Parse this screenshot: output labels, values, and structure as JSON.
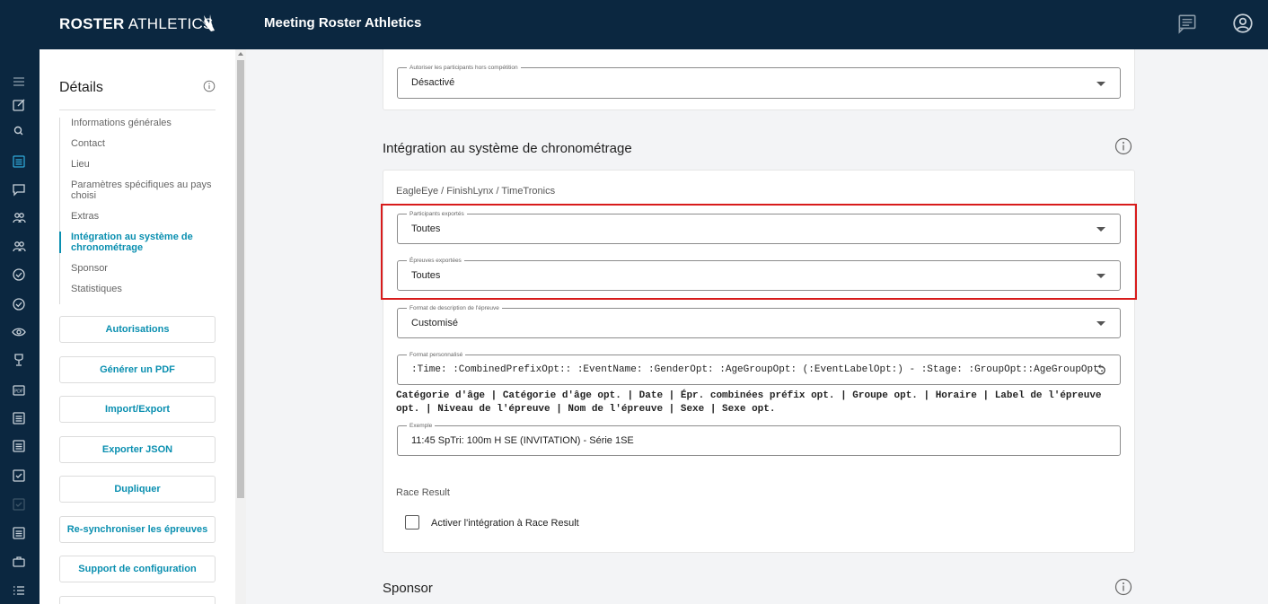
{
  "header": {
    "brand_bold": "ROSTER",
    "brand_light": "ATHLETICS",
    "app_title": "Meeting Roster Athletics",
    "icons": [
      "chat-icon",
      "account-icon"
    ]
  },
  "rail": {
    "icons": [
      "menu-icon",
      "edit-icon",
      "search-icon",
      "list-icon",
      "message-icon",
      "people-icon",
      "group-icon",
      "check-circle-icon",
      "check-circle-outline-icon",
      "eye-icon",
      "trophy-icon",
      "pdf-icon",
      "list-box-icon",
      "list-box-icon",
      "check-box-icon",
      "check-box-disabled-icon",
      "document-icon",
      "briefcase-icon",
      "list-bullets-icon"
    ]
  },
  "sidebar": {
    "title": "Détails",
    "nav": [
      {
        "label": "Informations générales"
      },
      {
        "label": "Contact"
      },
      {
        "label": "Lieu"
      },
      {
        "label": "Paramètres spécifiques au pays choisi"
      },
      {
        "label": "Extras"
      },
      {
        "label": "Intégration au système de chronométrage"
      },
      {
        "label": "Sponsor"
      },
      {
        "label": "Statistiques"
      }
    ],
    "buttons": [
      {
        "label": "Autorisations"
      },
      {
        "label": "Générer un PDF"
      },
      {
        "label": "Import/Export"
      },
      {
        "label": "Exporter JSON"
      },
      {
        "label": "Dupliquer"
      },
      {
        "label": "Re-synchroniser les épreuves"
      },
      {
        "label": "Support de configuration"
      }
    ]
  },
  "main": {
    "top_field": {
      "label": "Autoriser les participants hors compétition",
      "value": "Désactivé"
    },
    "timing": {
      "title": "Intégration au système de chronométrage",
      "subtitle": "EagleEye / FinishLynx / TimeTronics",
      "participants": {
        "label": "Participants exportés",
        "value": "Toutes"
      },
      "events": {
        "label": "Épreuves exportées",
        "value": "Toutes"
      },
      "format": {
        "label": "Format de description de l'épreuve",
        "value": "Customisé"
      },
      "custom_format": {
        "label": "Format personnalisé",
        "value": ":Time: :CombinedPrefixOpt:: :EventName: :GenderOpt: :AgeGroupOpt: (:EventLabelOpt:) - :Stage: :GroupOpt::AgeGroupOpt:"
      },
      "tokens_line1": "Catégorie d'âge | Catégorie d'âge opt. | Date | Épr. combinées préfix opt. | Groupe opt. | Horaire | Label de l'épreuve",
      "tokens_line2": "opt. | Niveau de l'épreuve | Nom de l'épreuve | Sexe | Sexe opt.",
      "example": {
        "label": "Exemple",
        "value": "11:45 SpTri: 100m H SE (INVITATION) - Série 1SE"
      },
      "race_result_title": "Race Result",
      "race_result_checkbox": "Activer l'intégration à Race Result",
      "race_result_checked": false
    },
    "sponsor_title": "Sponsor"
  },
  "colors": {
    "navy": "#0b2740",
    "accent": "#0a8fb0",
    "highlight": "#d81b1b"
  }
}
